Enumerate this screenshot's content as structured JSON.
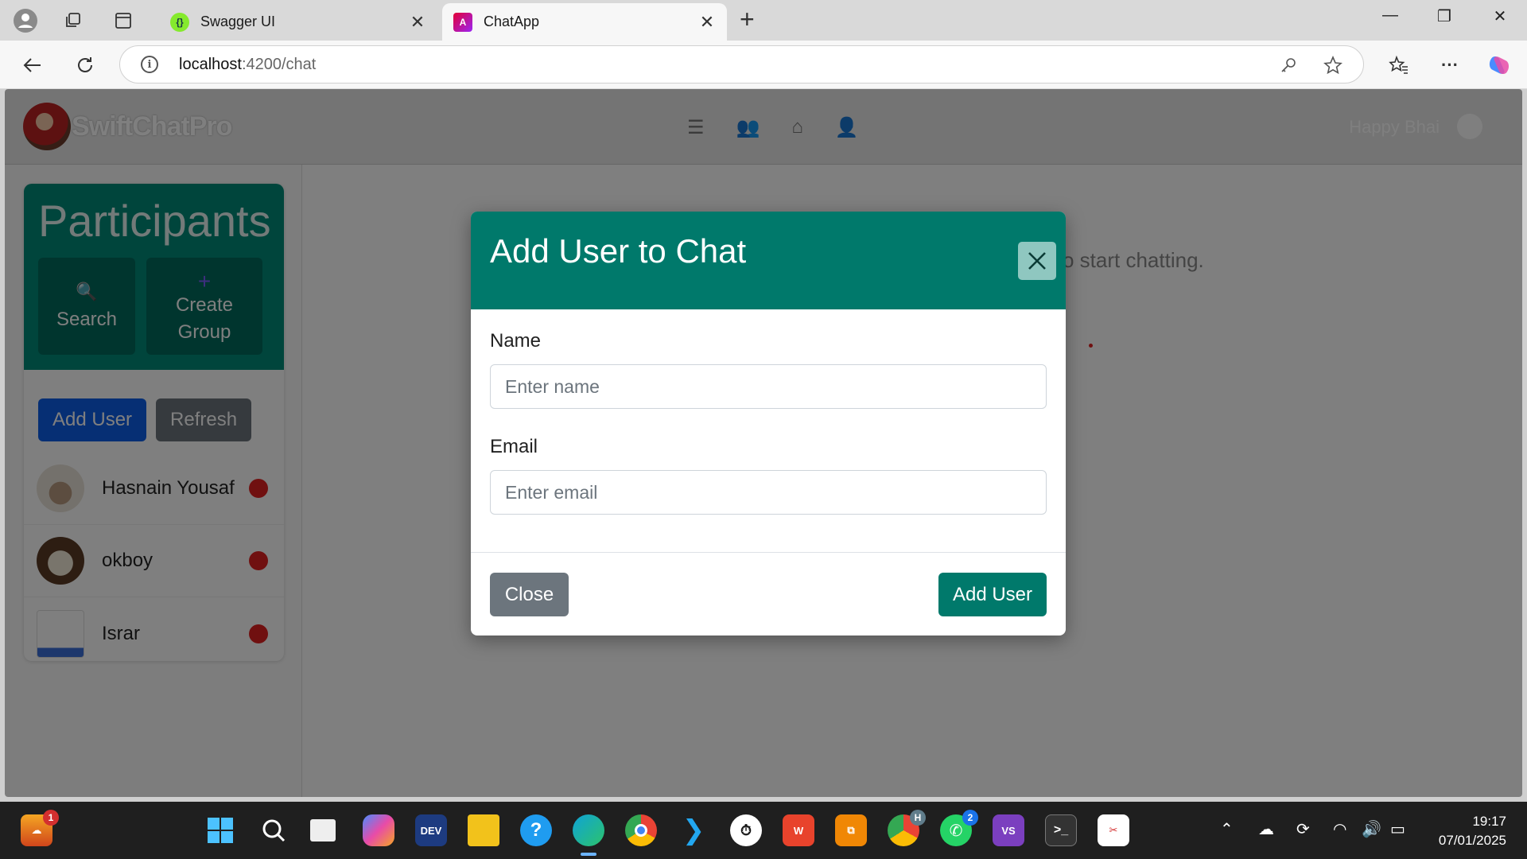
{
  "browser": {
    "tabs": [
      {
        "title": "Swagger UI",
        "active": false,
        "icon": "swagger-icon"
      },
      {
        "title": "ChatApp",
        "active": true,
        "icon": "angular-icon"
      }
    ],
    "url_host": "localhost",
    "url_path": ":4200/chat"
  },
  "app": {
    "brand": "SwiftChatPro",
    "user_name": "Happy Bhai"
  },
  "sidebar": {
    "title": "Participants",
    "search_label": "Search",
    "create_group_line1": "Create",
    "create_group_line2": "Group",
    "add_user_label": "Add User",
    "refresh_label": "Refresh",
    "contacts": [
      {
        "name": "Hasnain Yousaf",
        "status": "offline"
      },
      {
        "name": "okboy",
        "status": "offline"
      },
      {
        "name": "Israr",
        "status": "offline"
      }
    ]
  },
  "main": {
    "hint_text": "o start chatting."
  },
  "modal": {
    "title": "Add User to Chat",
    "name_label": "Name",
    "name_placeholder": "Enter name",
    "email_label": "Email",
    "email_placeholder": "Enter email",
    "close_label": "Close",
    "submit_label": "Add User"
  },
  "taskbar": {
    "time": "19:17",
    "date": "07/01/2025",
    "notification_badge": "1",
    "whatsapp_badge": "2",
    "chrome_badge": "H"
  },
  "colors": {
    "modal_header": "#00796b",
    "participants_header": "#008a78",
    "primary_button": "#0d5ee8",
    "secondary_button": "#6c757d",
    "status_offline": "#e02020"
  }
}
